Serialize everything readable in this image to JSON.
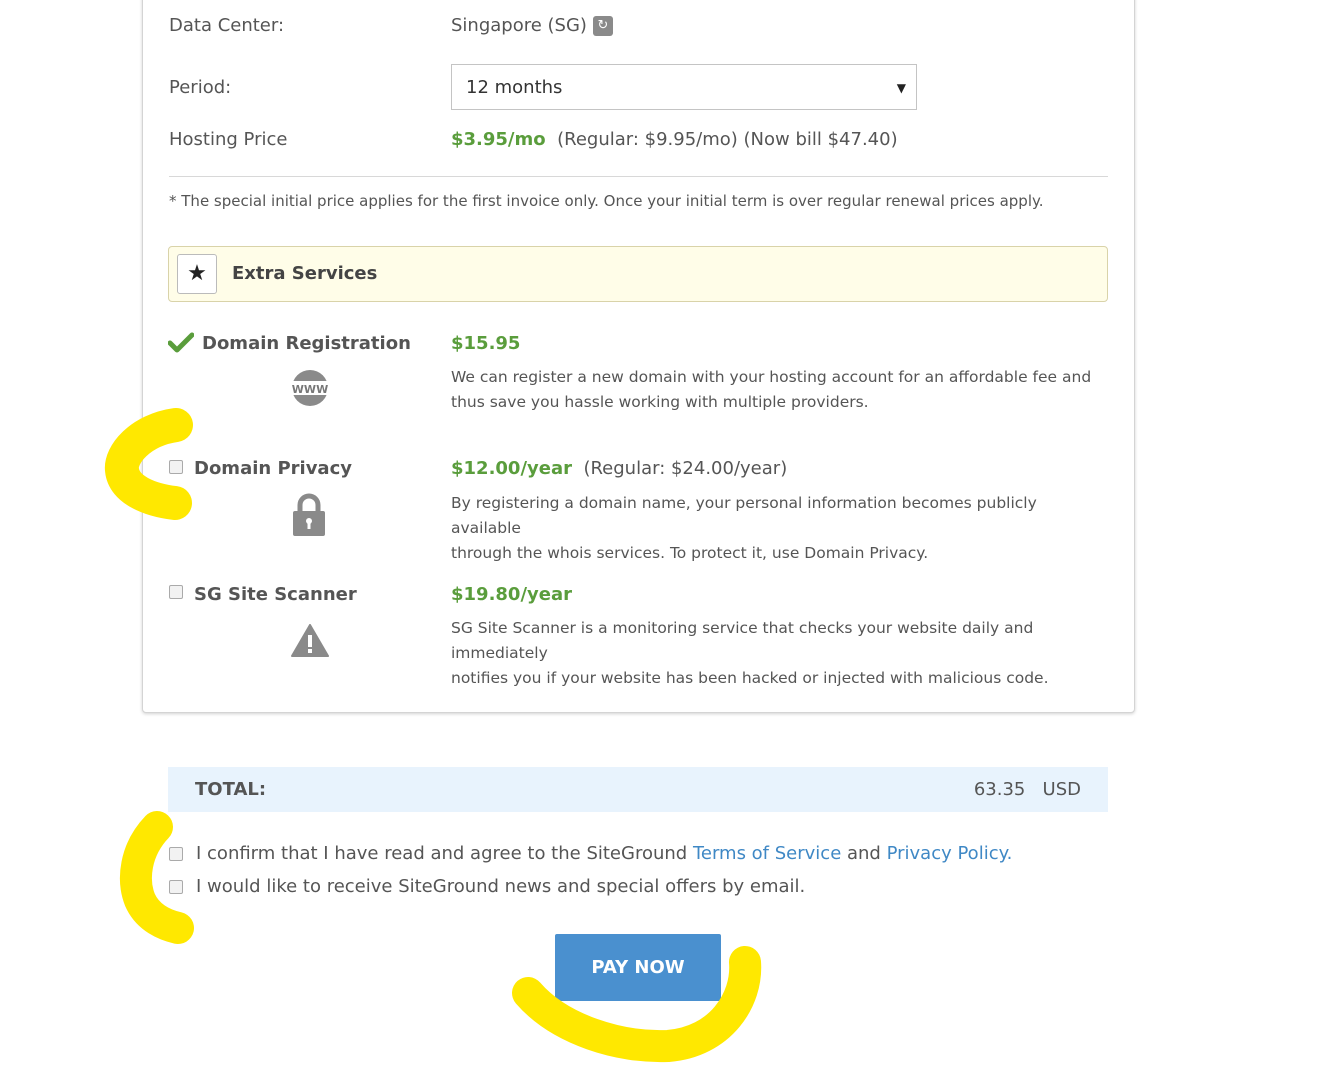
{
  "order": {
    "data_center": {
      "label": "Data Center:",
      "value": "Singapore (SG)",
      "icon": "refresh-icon"
    },
    "period": {
      "label": "Period:",
      "selected": "12 months"
    },
    "hosting_price": {
      "label": "Hosting Price",
      "price": "$3.95/mo",
      "regular": "(Regular: $9.95/mo) (Now bill $47.40)"
    },
    "note": "* The special initial price applies for the first invoice only. Once your initial term is over regular renewal prices apply."
  },
  "extras": {
    "title": "Extra Services",
    "items": [
      {
        "name": "Domain Registration",
        "price": "$15.95",
        "regular": "",
        "description_1": "We can register a new domain with your hosting account for an affordable fee and",
        "description_2": "thus save you hassle working with multiple providers.",
        "checked": true,
        "icon": "www-icon",
        "icon_text": "WWW"
      },
      {
        "name": "Domain Privacy",
        "price": "$12.00/year",
        "regular": "(Regular: $24.00/year)",
        "description_1": "By registering a domain name, your personal information becomes publicly available",
        "description_2": "through the whois services. To protect it, use Domain Privacy.",
        "checked": false,
        "icon": "lock-icon"
      },
      {
        "name": "SG Site Scanner",
        "price": "$19.80/year",
        "regular": "",
        "description_1": "SG Site Scanner is a monitoring service that checks your website daily and immediately",
        "description_2": "notifies you if your website has been hacked or injected with malicious code.",
        "checked": false,
        "icon": "warning-icon"
      }
    ]
  },
  "total": {
    "label": "TOTAL:",
    "amount": "63.35",
    "currency": "USD"
  },
  "agreements": {
    "terms_prefix": "I confirm that I have read and agree to the SiteGround ",
    "terms_link": "Terms of Service",
    "terms_and": " and ",
    "privacy_link": "Privacy Policy.",
    "news": "I would like to receive SiteGround news and special offers by email."
  },
  "pay_button": "PAY NOW",
  "colors": {
    "accent_green": "#5a9d3c",
    "button_blue": "#4a90cf",
    "link_blue": "#3f88c5",
    "highlight": "#ffe800"
  }
}
